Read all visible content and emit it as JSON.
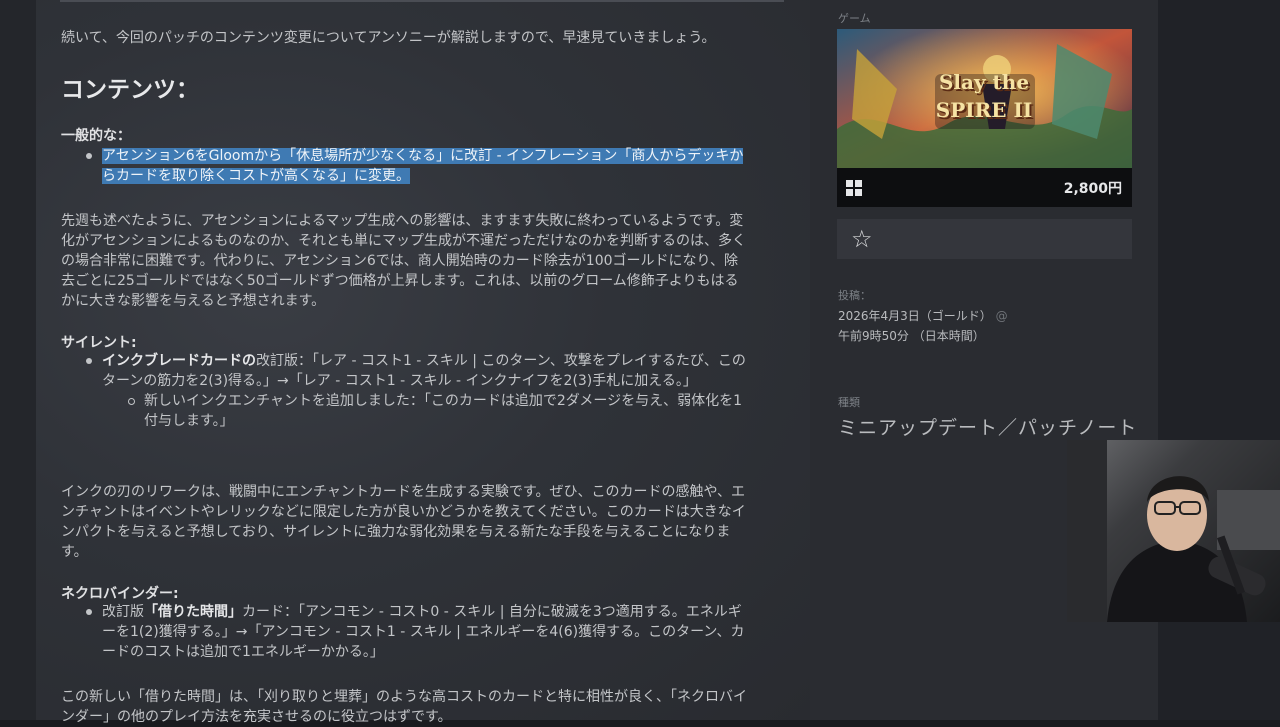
{
  "article": {
    "intro": "続いて、今回のパッチのコンテンツ変更についてアンソニーが解説しますので、早速見ていきましょう。",
    "heading": "コンテンツ：",
    "general": {
      "title": "一般的な：",
      "item_line1": "アセンション6をGloomから「休息場所が少なくなる」に改訂 - インフレーション「商人からデッキか",
      "item_line2": "らカードを取り除くコストが高くなる」に変更。"
    },
    "para2": [
      "先週も述べたように、アセンションによるマップ生成への影響は、ますます失敗に終わっているようです。変",
      "化がアセンションによるものなのか、それとも単にマップ生成が不運だっただけなのかを判断するのは、多く",
      "の場合非常に困難です。代わりに、アセンション6では、商人開始時のカード除去が100ゴールドになり、除",
      "去ごとに25ゴールドではなく50ゴールドずつ価格が上昇します。これは、以前のグローム修飾子よりもはる",
      "かに大きな影響を与えると予想されます。"
    ],
    "silent": {
      "title": "サイレント:",
      "card_bold": "インクブレードカードの",
      "line1_rest": "改訂版：「レア - コスト1 - スキル | このターン、攻撃をプレイするたび、この",
      "line2": "ターンの筋力を2(3)得る。」→「レア - コスト1 - スキル - インクナイフを2(3)手札に加える。」",
      "sub_line1": "新しいインクエンチャントを追加しました：「このカードは追加で2ダメージを与え、弱体化を1",
      "sub_line2": "付与します。」"
    },
    "para3": [
      "インクの刃のリワークは、戦闘中にエンチャントカードを生成する実験です。ぜひ、このカードの感触や、エ",
      "ンチャントはイベントやレリックなどに限定した方が良いかどうかを教えてください。このカードは大きなイ",
      "ンパクトを与えると予想しており、サイレントに強力な弱化効果を与える新たな手段を与えることになりま",
      "す。"
    ],
    "necro": {
      "title": "ネクロバインダー:",
      "prefix": "改訂版",
      "card_bold": "「借りた時間」",
      "line1_rest": "カード：「アンコモン - コスト0 - スキル | 自分に破滅を3つ適用する。エネルギ",
      "line2": "ーを1(2)獲得する。」→「アンコモン - コスト1 - スキル | エネルギーを4(6)獲得する。このターン、カ",
      "line3": "ードのコストは追加で1エネルギーかかる。」"
    },
    "para4": [
      "この新しい「借りた時間」は、「刈り取りと埋葬」のような高コストのカードと特に相性が良く、「ネクロバイ",
      "ンダー」の他のプレイ方法を充実させるのに役立つはずです。"
    ]
  },
  "sidebar": {
    "game_label": "ゲーム",
    "game_title_art": "Slay the SPIRE II",
    "price": "2,800円",
    "posted_label": "投稿：",
    "posted_date": "2026年4月3日（ゴールド）",
    "posted_at": "@",
    "posted_time": "午前9時50分 （日本時間）",
    "category_label": "種類",
    "category_value": "ミニアップデート／パッチノート"
  },
  "icons": {
    "platform": "windows-icon",
    "favorite": "star-icon"
  },
  "colors": {
    "selection_highlight": "#3f7ab3",
    "background": "#2f3238"
  }
}
